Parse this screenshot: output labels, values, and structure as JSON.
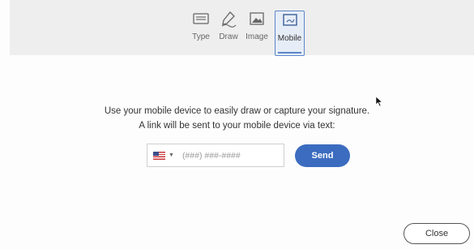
{
  "tabs": [
    {
      "label": "Type",
      "icon": "keyboard-icon"
    },
    {
      "label": "Draw",
      "icon": "pen-draw-icon"
    },
    {
      "label": "Image",
      "icon": "image-icon"
    },
    {
      "label": "Mobile",
      "icon": "mobile-device-icon",
      "active": true
    }
  ],
  "message": {
    "line1": "Use your mobile device to easily draw or capture your signature.",
    "line2": "A link will be sent to your mobile device via text:"
  },
  "phone": {
    "country_icon": "us-flag-icon",
    "placeholder": "(###) ###-####",
    "value": ""
  },
  "send_label": "Send",
  "close_label": "Close",
  "colors": {
    "accent": "#3c6cbf",
    "active_tab_border": "#5b86c8",
    "toolbar_bg": "#eeeeee"
  }
}
